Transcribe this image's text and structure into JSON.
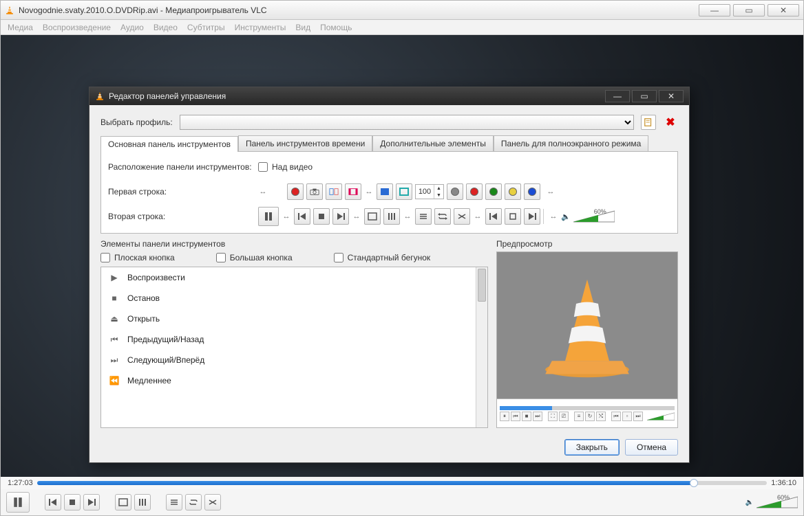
{
  "window": {
    "title": "Novogodnie.svaty.2010.O.DVDRip.avi - Медиапроигрыватель VLC"
  },
  "menubar": [
    "Медиа",
    "Воспроизведение",
    "Аудио",
    "Видео",
    "Субтитры",
    "Инструменты",
    "Вид",
    "Помощь"
  ],
  "seek": {
    "current": "1:27:03",
    "total": "1:36:10"
  },
  "volume": {
    "percent": "60%"
  },
  "dialog": {
    "title": "Редактор панелей управления",
    "profile_label": "Выбрать профиль:",
    "tabs": [
      "Основная панель инструментов",
      "Панель инструментов времени",
      "Дополнительные элементы",
      "Панель для полноэкранного режима"
    ],
    "placement_label": "Расположение панели инструментов:",
    "above_video": "Над видео",
    "row1_label": "Первая строка:",
    "row2_label": "Вторая строка:",
    "spinner_value": "100",
    "elements": {
      "heading": "Элементы панели инструментов",
      "flat": "Плоская кнопка",
      "big": "Большая кнопка",
      "std_seek": "Стандартный бегунок",
      "items": [
        "Воспроизвести",
        "Останов",
        "Открыть",
        "Предыдущий/Назад",
        "Следующий/Вперёд",
        "Медленнее"
      ]
    },
    "preview": {
      "heading": "Предпросмотр",
      "volume": "60%"
    },
    "close_btn": "Закрыть",
    "cancel_btn": "Отмена"
  }
}
